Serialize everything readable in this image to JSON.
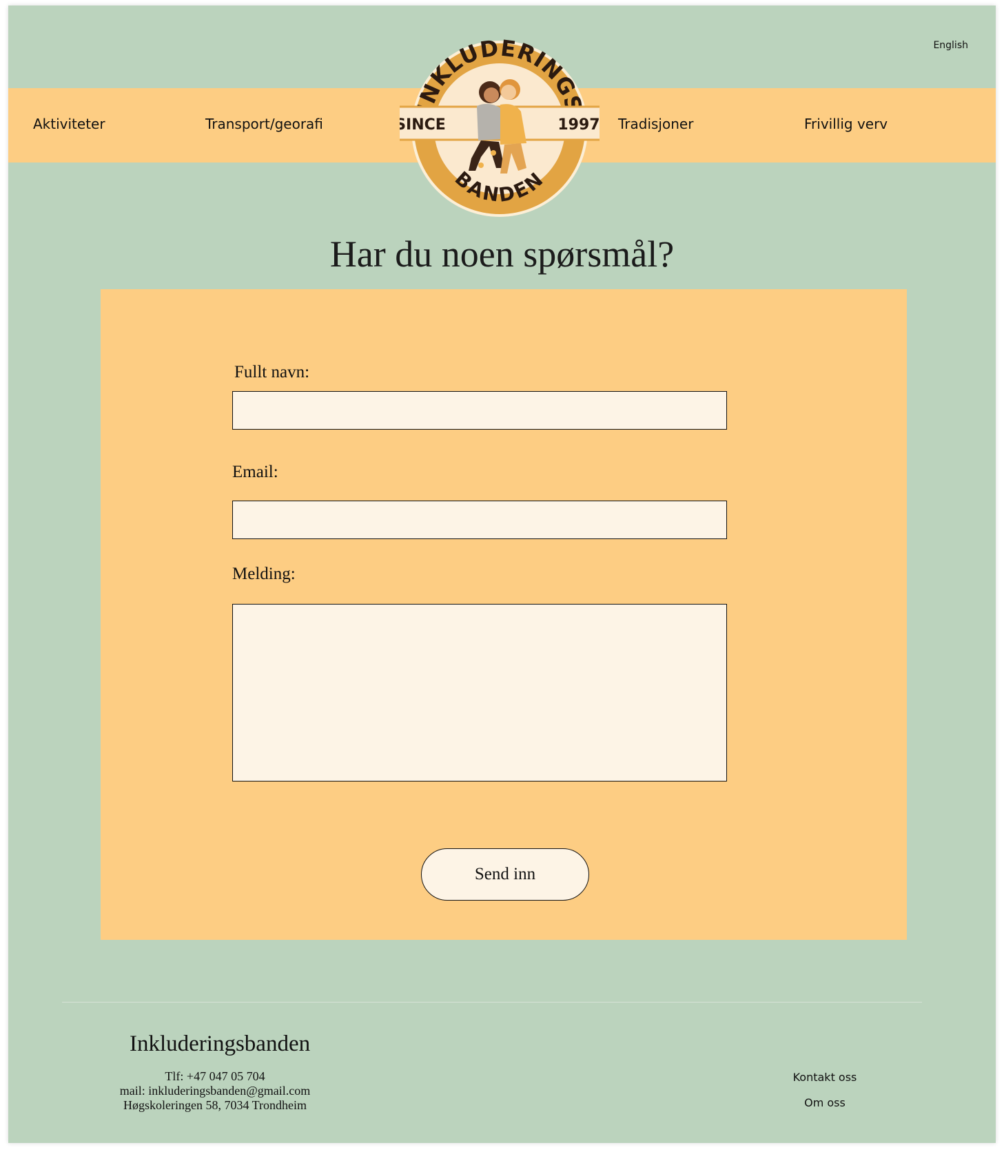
{
  "header": {
    "language_label": "English",
    "nav": [
      "Aktiviteter",
      "Transport/georafi",
      "Tradisjoner",
      "Frivillig verv"
    ],
    "logo": {
      "top_text": "INKLUDERINGS",
      "bottom_text": "BANDEN",
      "left_text": "SINCE",
      "right_text": "1997"
    }
  },
  "main": {
    "title": "Har du noen spørsmål?",
    "form": {
      "name_label": "Fullt navn:",
      "name_value": "",
      "email_label": "Email:",
      "email_value": "",
      "message_label": "Melding:",
      "message_value": "",
      "submit_label": "Send inn"
    }
  },
  "footer": {
    "name": "Inkluderingsbanden",
    "phone": "Tlf: +47 047 05 704",
    "email": "mail: inkluderingsbanden@gmail.com",
    "address": "Høgskoleringen 58,  7034 Trondheim",
    "links": [
      "Kontakt oss",
      "Om oss"
    ]
  },
  "colors": {
    "background": "#bbd3bd",
    "accent": "#fdcd83",
    "field": "#fdf4e6",
    "logo_ring": "#e2a443"
  }
}
